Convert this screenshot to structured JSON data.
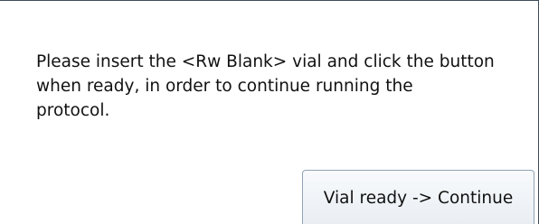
{
  "dialog": {
    "message": "Please insert the <Rw Blank> vial and click the button\nwhen ready, in order to continue running the\nprotocol.",
    "continue_label": "Vial ready -> Continue"
  }
}
